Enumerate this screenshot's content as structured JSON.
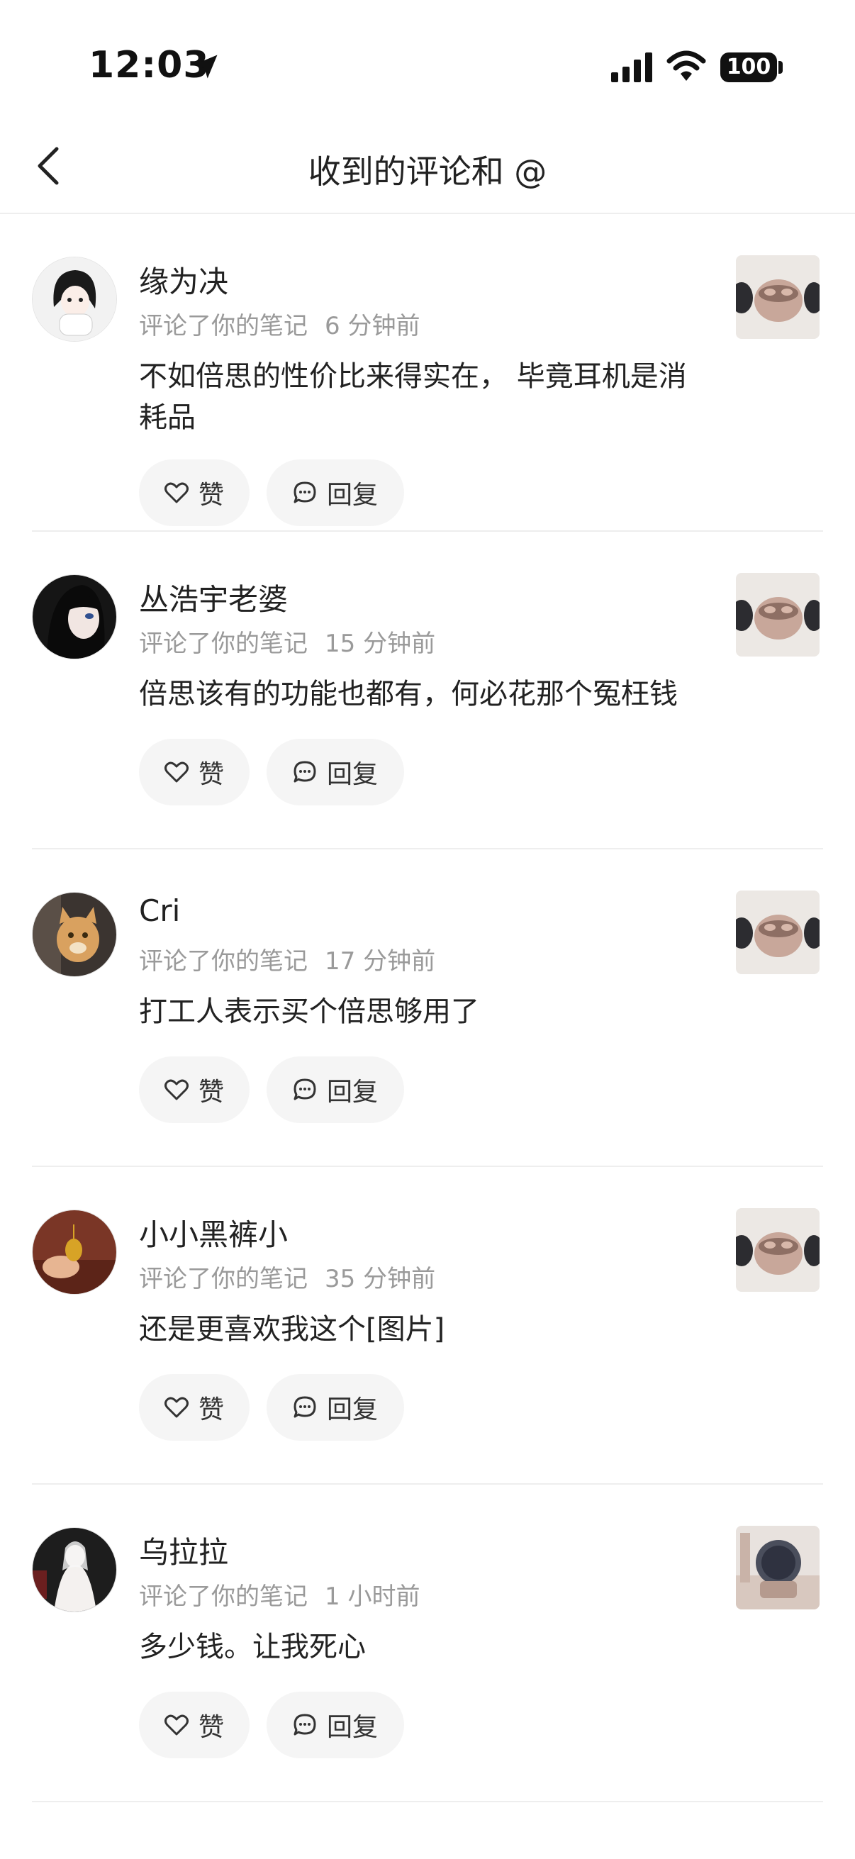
{
  "status": {
    "time": "12:03",
    "battery": "100"
  },
  "nav": {
    "title": "收到的评论和 @"
  },
  "actions": {
    "like_label": "赞",
    "reply_label": "回复"
  },
  "comments": [
    {
      "name": "缘为决",
      "action": "评论了你的笔记",
      "time": "6 分钟前",
      "text": "不如倍思的性价比来得实在， 毕竟耳机是消耗品"
    },
    {
      "name": "丛浩宇老婆",
      "action": "评论了你的笔记",
      "time": "15 分钟前",
      "text": "倍思该有的功能也都有，何必花那个冤枉钱"
    },
    {
      "name": "Cri",
      "action": "评论了你的笔记",
      "time": "17 分钟前",
      "text": "打工人表示买个倍思够用了"
    },
    {
      "name": "小小黑裤小",
      "action": "评论了你的笔记",
      "time": "35 分钟前",
      "text": "还是更喜欢我这个[图片]"
    },
    {
      "name": "乌拉拉",
      "action": "评论了你的笔记",
      "time": "1 小时前",
      "text": "多少钱。让我死心"
    }
  ]
}
